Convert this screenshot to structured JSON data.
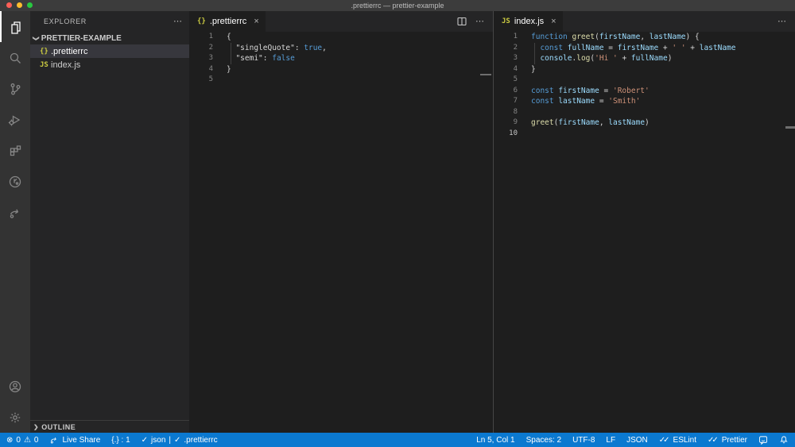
{
  "window": {
    "title": ".prettierrc — prettier-example"
  },
  "colors": {
    "statusbar": "#0b79d0",
    "titlebar": "#3c3c3c",
    "activitybar": "#333333",
    "sidebar": "#252526",
    "editor": "#1e1e1e",
    "selection": "#37373d",
    "keyword": "#569cd6",
    "function": "#dcdcaa",
    "variable": "#9cdcfe",
    "string": "#ce9178",
    "file_icon_yellow": "#cbcb41"
  },
  "icons": {
    "error": "⊗",
    "warning": "⚠",
    "check": "✓",
    "double_check": "✓✓",
    "ellipsis": "⋯",
    "chevron_down": "❯",
    "chevron_collapsed": "❯",
    "close": "✕",
    "json_braces": "{}",
    "js_badge": "JS"
  },
  "activity_bar": {
    "items": [
      {
        "name": "explorer",
        "active": true
      },
      {
        "name": "search",
        "active": false
      },
      {
        "name": "source-control",
        "active": false
      },
      {
        "name": "run-and-debug",
        "active": false
      },
      {
        "name": "extensions",
        "active": false
      },
      {
        "name": "test-session",
        "active": false
      },
      {
        "name": "live-share",
        "active": false
      },
      {
        "name": "account",
        "active": false
      },
      {
        "name": "settings",
        "active": false
      }
    ]
  },
  "sidebar": {
    "title": "EXPLORER",
    "root": "PRETTIER-EXAMPLE",
    "files": [
      {
        "icon": "{}",
        "label": ".prettierrc",
        "selected": true
      },
      {
        "icon": "JS",
        "label": "index.js",
        "selected": false
      }
    ],
    "outline": "OUTLINE"
  },
  "editors": [
    {
      "tab": {
        "icon": "{}",
        "label": ".prettierrc"
      },
      "cursor_line": null,
      "lines": [
        [
          [
            "pun",
            "{"
          ]
        ],
        [
          [
            "ws",
            "  "
          ],
          [
            "key",
            "\"singleQuote\""
          ],
          [
            "pun",
            ": "
          ],
          [
            "kw",
            "true"
          ],
          [
            "pun",
            ","
          ]
        ],
        [
          [
            "ws",
            "  "
          ],
          [
            "key",
            "\"semi\""
          ],
          [
            "pun",
            ": "
          ],
          [
            "kw",
            "false"
          ]
        ],
        [
          [
            "pun",
            "}"
          ]
        ],
        []
      ]
    },
    {
      "tab": {
        "icon": "JS",
        "label": "index.js"
      },
      "cursor_line": 10,
      "lines": [
        [
          [
            "kw",
            "function "
          ],
          [
            "fn",
            "greet"
          ],
          [
            "pun",
            "("
          ],
          [
            "var",
            "firstName"
          ],
          [
            "pun",
            ", "
          ],
          [
            "var",
            "lastName"
          ],
          [
            "pun",
            ") {"
          ]
        ],
        [
          [
            "ws",
            "  "
          ],
          [
            "kw",
            "const "
          ],
          [
            "var",
            "fullName"
          ],
          [
            "pun",
            " = "
          ],
          [
            "var",
            "firstName"
          ],
          [
            "pun",
            " + "
          ],
          [
            "str",
            "' '"
          ],
          [
            "pun",
            " + "
          ],
          [
            "var",
            "lastName"
          ]
        ],
        [
          [
            "ws",
            "  "
          ],
          [
            "var",
            "console"
          ],
          [
            "pun",
            "."
          ],
          [
            "fn",
            "log"
          ],
          [
            "pun",
            "("
          ],
          [
            "str",
            "'Hi '"
          ],
          [
            "pun",
            " + "
          ],
          [
            "var",
            "fullName"
          ],
          [
            "pun",
            ")"
          ]
        ],
        [
          [
            "pun",
            "}"
          ]
        ],
        [],
        [
          [
            "kw",
            "const "
          ],
          [
            "var",
            "firstName"
          ],
          [
            "pun",
            " = "
          ],
          [
            "str",
            "'Robert'"
          ]
        ],
        [
          [
            "kw",
            "const "
          ],
          [
            "var",
            "lastName"
          ],
          [
            "pun",
            " = "
          ],
          [
            "str",
            "'Smith'"
          ]
        ],
        [],
        [
          [
            "fn",
            "greet"
          ],
          [
            "pun",
            "("
          ],
          [
            "var",
            "firstName"
          ],
          [
            "pun",
            ", "
          ],
          [
            "var",
            "lastName"
          ],
          [
            "pun",
            ")"
          ]
        ],
        []
      ]
    }
  ],
  "statusbar": {
    "problems": {
      "errors": "0",
      "warnings": "0"
    },
    "live_share": "Live Share",
    "brackets": "{.} : 1",
    "formatter_a": "json",
    "formatter_sep": "|",
    "formatter_b": ".prettierrc",
    "cursor": "Ln 5, Col 1",
    "indentation": "Spaces: 2",
    "encoding": "UTF-8",
    "eol": "LF",
    "language": "JSON",
    "eslint": "ESLint",
    "prettier": "Prettier"
  }
}
